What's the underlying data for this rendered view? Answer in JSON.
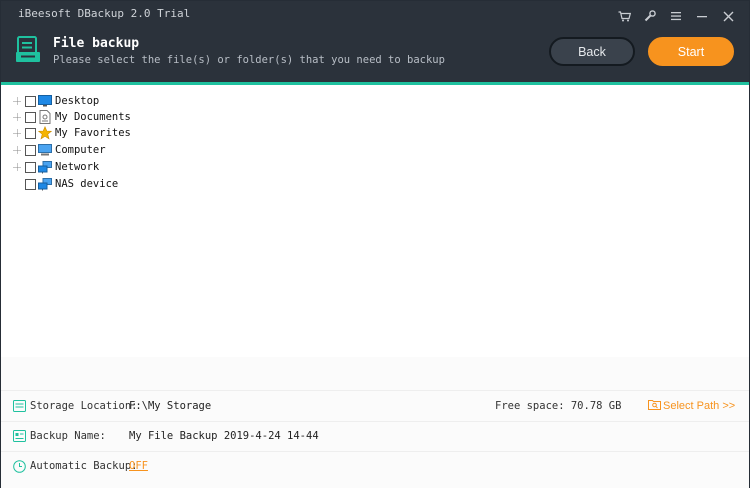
{
  "window": {
    "title": "iBeesoft DBackup 2.0 Trial",
    "controls": [
      "cart-icon",
      "settings-icon",
      "menu-icon",
      "minimize-icon",
      "close-icon"
    ]
  },
  "header": {
    "title": "File backup",
    "subtitle": "Please select the file(s) or folder(s) that you need to backup",
    "back_label": "Back",
    "start_label": "Start"
  },
  "tree": {
    "items": [
      {
        "label": "Desktop",
        "icon": "desktop-icon",
        "expandable": true,
        "checked": false
      },
      {
        "label": "My Documents",
        "icon": "documents-icon",
        "expandable": true,
        "checked": false
      },
      {
        "label": "My Favorites",
        "icon": "star-icon",
        "expandable": true,
        "checked": false
      },
      {
        "label": "Computer",
        "icon": "computer-icon",
        "expandable": true,
        "checked": false
      },
      {
        "label": "Network",
        "icon": "network-icon",
        "expandable": true,
        "checked": false
      },
      {
        "label": "NAS device",
        "icon": "network-icon",
        "expandable": false,
        "checked": false
      }
    ]
  },
  "bottom": {
    "storage_label": "Storage Location:",
    "storage_value": "F:\\My Storage",
    "free_space": "Free space: 70.78 GB",
    "select_path": "Select Path >>",
    "backup_name_label": "Backup Name:",
    "backup_name_value": "My File Backup 2019-4-24 14-44",
    "auto_backup_label": "Automatic Backup:",
    "auto_backup_value": "OFF"
  },
  "colors": {
    "header_bg": "#2b323b",
    "accent_teal": "#1fc19f",
    "accent_orange": "#f7931e"
  }
}
